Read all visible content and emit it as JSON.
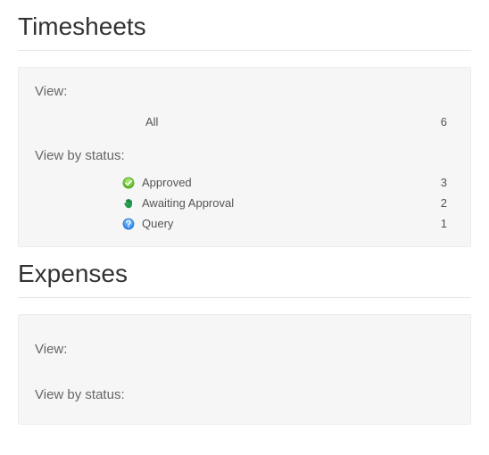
{
  "timesheets": {
    "title": "Timesheets",
    "view_label": "View:",
    "all": {
      "label": "All",
      "count": "6"
    },
    "status_label": "View by status:",
    "statuses": [
      {
        "icon": "check-circle-icon",
        "label": "Approved",
        "count": "3"
      },
      {
        "icon": "hand-icon",
        "label": "Awaiting Approval",
        "count": "2"
      },
      {
        "icon": "question-circle-icon",
        "label": "Query",
        "count": "1"
      }
    ]
  },
  "expenses": {
    "title": "Expenses",
    "view_label": "View:",
    "status_label": "View by status:"
  }
}
